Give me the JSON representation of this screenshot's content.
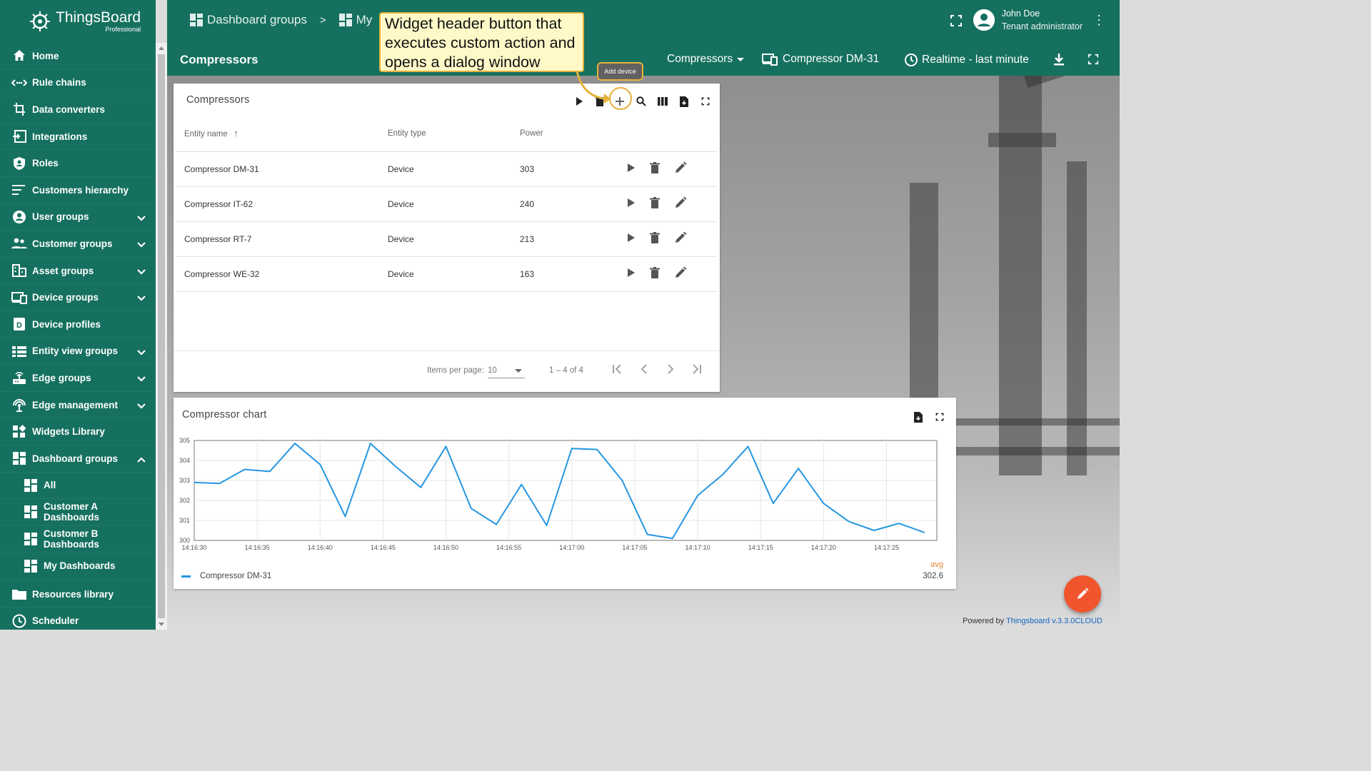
{
  "brand": {
    "name": "ThingsBoard",
    "subtitle": "Professional"
  },
  "sidebar": {
    "items": [
      {
        "label": "Home",
        "icon": "home-icon"
      },
      {
        "label": "Rule chains",
        "icon": "rule-chains-icon"
      },
      {
        "label": "Data converters",
        "icon": "data-converters-icon"
      },
      {
        "label": "Integrations",
        "icon": "integrations-icon"
      },
      {
        "label": "Roles",
        "icon": "shield-icon"
      },
      {
        "label": "Customers hierarchy",
        "icon": "hierarchy-icon"
      },
      {
        "label": "User groups",
        "icon": "account-circle-icon"
      },
      {
        "label": "Customer groups",
        "icon": "people-icon"
      },
      {
        "label": "Asset groups",
        "icon": "domain-icon"
      },
      {
        "label": "Device groups",
        "icon": "devices-icon"
      },
      {
        "label": "Device profiles",
        "icon": "device-profile-icon"
      },
      {
        "label": "Entity view groups",
        "icon": "view-list-icon"
      },
      {
        "label": "Edge groups",
        "icon": "router-icon"
      },
      {
        "label": "Edge management",
        "icon": "settings-input-antenna-icon"
      },
      {
        "label": "Widgets Library",
        "icon": "widgets-icon"
      },
      {
        "label": "Dashboard groups",
        "icon": "dashboard-icon"
      },
      {
        "label": "All",
        "icon": "dashboard-icon"
      },
      {
        "label": "Customer A Dashboards",
        "icon": "dashboard-icon"
      },
      {
        "label": "Customer B Dashboards",
        "icon": "dashboard-icon"
      },
      {
        "label": "My Dashboards",
        "icon": "dashboard-icon"
      },
      {
        "label": "Resources library",
        "icon": "folder-icon"
      },
      {
        "label": "Scheduler",
        "icon": "schedule-icon"
      }
    ]
  },
  "topbar": {
    "breadcrumbs": [
      "Dashboard groups",
      "My"
    ],
    "breadcrumb_sep": ">",
    "user_name": "John Doe",
    "user_role": "Tenant administrator"
  },
  "dashbar": {
    "title": "Compressors",
    "state_select": "Compressors",
    "entity": "Compressor DM-31",
    "timewindow": "Realtime - last minute"
  },
  "table_widget": {
    "title": "Compressors",
    "columns": [
      "Entity name",
      "Entity type",
      "Power"
    ],
    "sort_indicator": "↑",
    "rows": [
      {
        "name": "Compressor DM-31",
        "type": "Device",
        "power": "303"
      },
      {
        "name": "Compressor IT-62",
        "type": "Device",
        "power": "240"
      },
      {
        "name": "Compressor RT-7",
        "type": "Device",
        "power": "213"
      },
      {
        "name": "Compressor WE-32",
        "type": "Device",
        "power": "163"
      }
    ],
    "pager": {
      "label": "Items per page:",
      "page_size": "10",
      "range": "1 – 4 of 4"
    },
    "add_tooltip": "Add device"
  },
  "callout": {
    "text": "Widget header button that executes custom action and opens a dialog window"
  },
  "chart_widget": {
    "title": "Compressor chart",
    "legend_name": "Compressor DM-31",
    "avg_label": "avg",
    "avg_value": "302.6"
  },
  "chart_data": {
    "type": "line",
    "title": "Compressor chart",
    "xlabel": "",
    "ylabel": "",
    "ylim": [
      300,
      305
    ],
    "yticks": [
      "300",
      "301",
      "302",
      "303",
      "304",
      "305"
    ],
    "xticks": [
      "14:16:30",
      "14:16:35",
      "14:16:40",
      "14:16:45",
      "14:16:50",
      "14:16:55",
      "14:17:00",
      "14:17:05",
      "14:17:10",
      "14:17:15",
      "14:17:20",
      "14:17:25"
    ],
    "xlim": [
      "14:16:30",
      "14:17:29"
    ],
    "grid": true,
    "legend": "bottom-left",
    "series": [
      {
        "name": "Compressor DM-31",
        "color": "#2596e2",
        "x": [
          "14:16:30",
          "14:16:32",
          "14:16:34",
          "14:16:36",
          "14:16:38",
          "14:16:40",
          "14:16:42",
          "14:16:44",
          "14:16:46",
          "14:16:48",
          "14:16:50",
          "14:16:52",
          "14:16:54",
          "14:16:56",
          "14:16:58",
          "14:17:00",
          "14:17:02",
          "14:17:04",
          "14:17:06",
          "14:17:08",
          "14:17:10",
          "14:17:12",
          "14:17:14",
          "14:17:16",
          "14:17:18",
          "14:17:20",
          "14:17:22",
          "14:17:24",
          "14:17:26",
          "14:17:28"
        ],
        "values": [
          302.9,
          302.85,
          303.55,
          303.45,
          304.85,
          303.8,
          301.2,
          304.85,
          303.7,
          302.65,
          304.7,
          301.6,
          300.8,
          302.8,
          300.75,
          304.6,
          304.55,
          303.0,
          300.3,
          300.1,
          302.25,
          303.3,
          304.7,
          301.85,
          303.6,
          301.85,
          300.95,
          300.5,
          300.85,
          300.4
        ]
      }
    ]
  },
  "footer": {
    "powered_by": "Powered by",
    "link": "Thingsboard v.3.3.0CLOUD"
  },
  "colors": {
    "primary": "#15705f",
    "accent": "#f0552d",
    "series": "#2596e2",
    "highlight": "#e6b23a"
  }
}
